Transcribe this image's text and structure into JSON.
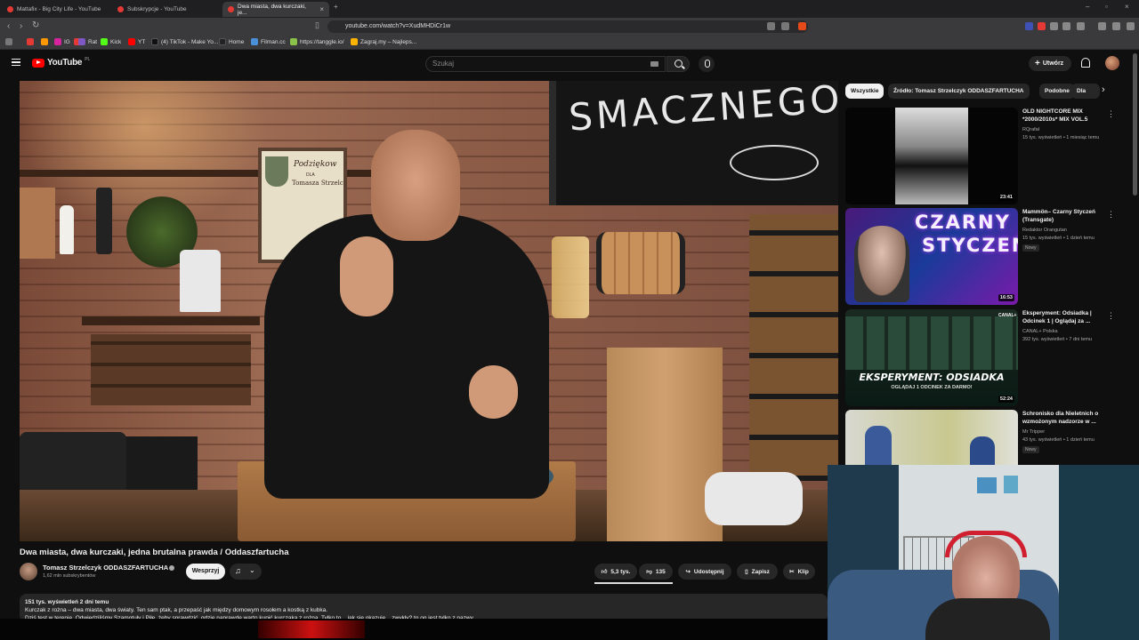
{
  "browser": {
    "tabs": [
      {
        "label": "Mattafix - Big City Life - YouTube"
      },
      {
        "label": "Subskrypcje - YouTube"
      },
      {
        "label": "Dwa miasta, dwa kurczaki, je..."
      }
    ],
    "new_tab": "+",
    "url": "youtube.com/watch?v=XudMHDiCr1w",
    "bookmarks": [
      {
        "label": "",
        "color": "#e53935"
      },
      {
        "label": "",
        "color": "#ff9800"
      },
      {
        "label": "IG",
        "color": "#d6249f"
      },
      {
        "label": "",
        "color": "#e53935"
      },
      {
        "label": "Rat",
        "color": "#7e57c2"
      },
      {
        "label": "Kick",
        "color": "#53fc18"
      },
      {
        "label": "YT",
        "color": "#ff0000"
      },
      {
        "label": "(4) TikTok - Make Yo...",
        "color": "#111111"
      },
      {
        "label": "Home",
        "color": "#222222"
      },
      {
        "label": "Filman.cc",
        "color": "#4a90d9"
      },
      {
        "label": "https://tanggle.io/",
        "color": "#8bc34a"
      },
      {
        "label": "Zagraj.my – Najleps...",
        "color": "#ffb300"
      }
    ]
  },
  "youtube": {
    "logo_text": "YouTube",
    "logo_country": "PL",
    "search_placeholder": "Szukaj",
    "create_label": "Utwórz",
    "video": {
      "title": "Dwa miasta, dwa kurczaki, jedna brutalna prawda / Oddaszfartucha",
      "chalk_text": "SMACZNEGO",
      "frame_text": "Podziękow",
      "frame_sub": "DLA",
      "frame_name": "Tomasza Strzelc"
    },
    "channel": {
      "name": "Tomasz Strzelczyk ODDASZFARTUCHA",
      "subs": "1,62 mln subskrybentów",
      "join_label": "Wesprzyj"
    },
    "actions": {
      "likes": "5,3 tys.",
      "dislikes": "135",
      "share": "Udostępnij",
      "save": "Zapisz",
      "clip": "Klip"
    },
    "description": {
      "stats": "151 tys. wyświetleń  2 dni temu",
      "line1": "Kurczak z rożna – dwa miasta, dwa światy. Ten sam ptak, a przepaść jak między domowym rosołem a kostką z kubka.",
      "line2": "Dziś test w terenie. Odwiedziliśmy Szamotuły i Piłę, żeby sprawdzić, gdzie naprawdę warto kupić kurczaka z rożna. Tylko to... jak się okazuje... zwykły? to on jest tylko z nazwy..."
    },
    "chips": [
      "Wszystkie",
      "Źródło: Tomasz Strzelczyk ODDASZFARTUCHA",
      "Podobne",
      "Dla"
    ],
    "recommendations": [
      {
        "title": "OLD NIGHTCORE MIX *2000/2010s* MIX VOL.5",
        "channel": "RQrafał",
        "meta": "15 tys. wyświetleń • 1 miesiąc temu",
        "duration": "23:41",
        "badge": ""
      },
      {
        "title": "Mammön– Czarny Styczeń (Transgate)",
        "channel": "Redaktor Orangutan",
        "meta": "15 tys. wyświetleń • 1 dzień temu",
        "duration": "16:53",
        "badge": "Nowy",
        "thumb_text1": "CZARNY",
        "thumb_text2": "STYCZEŃ"
      },
      {
        "title": "Eksperyment: Odsiadka | Odcinek 1 | Oglądaj za ...",
        "channel": "CANAL+ Polska",
        "meta": "392 tys. wyświetleń • 7 dni temu",
        "duration": "52:24",
        "badge": "",
        "thumb_text1": "EKSPERYMENT: ODSIADKA",
        "thumb_text2": "OGLĄDAJ 1 ODCINEK ZA DARMO!",
        "thumb_logo": "CANAL+"
      },
      {
        "title": "Schronisko dla Nieletnich o wzmożonym nadzorze w ...",
        "channel": "Mr Tripper",
        "meta": "43 tys. wyświetleń • 1 dzień temu",
        "duration": "",
        "badge": "Nowy"
      }
    ]
  }
}
